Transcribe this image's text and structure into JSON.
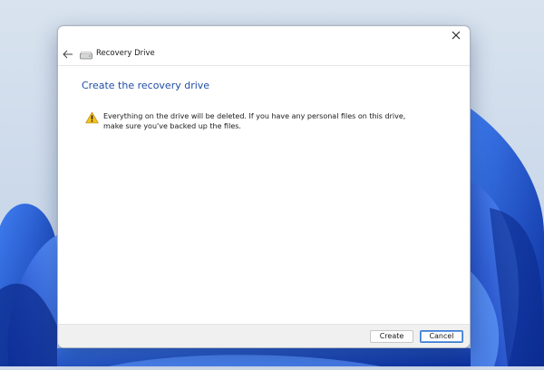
{
  "window": {
    "title": "Recovery Drive",
    "icons": {
      "close": "close-icon",
      "back": "back-arrow-icon",
      "app": "drive-icon"
    }
  },
  "content": {
    "heading": "Create the recovery drive",
    "warning_icon": "warning-icon",
    "message": "Everything on the drive will be deleted. If you have any personal files on this drive, make sure you've backed up the files."
  },
  "footer": {
    "create_label": "Create",
    "cancel_label": "Cancel"
  },
  "colors": {
    "heading": "#1f4ea6",
    "warning": "#f5c21b",
    "accent": "#3a78cf",
    "desktop_blue": "#1b47c9"
  }
}
